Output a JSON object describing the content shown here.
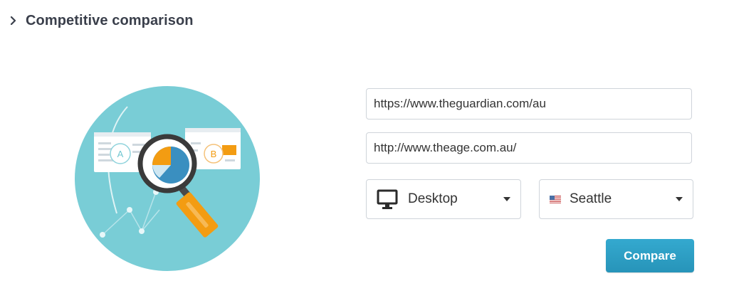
{
  "section": {
    "title": "Competitive comparison",
    "chevron_icon": "chevron-right-icon"
  },
  "illustration": {
    "icon": "magnifier-comparison-illustration",
    "badge_a": "A",
    "badge_b": "B",
    "colors": {
      "circle": "#79cdd6",
      "accent": "#f39c12",
      "pie": "#3a8fc0"
    }
  },
  "form": {
    "url_a": {
      "value": "https://www.theguardian.com/au"
    },
    "url_b": {
      "value": "http://www.theage.com.au/"
    },
    "device": {
      "icon": "desktop-monitor-icon",
      "selected": "Desktop"
    },
    "location": {
      "icon": "us-flag-icon",
      "selected": "Seattle"
    },
    "compare_label": "Compare"
  },
  "colors": {
    "button": "#2ea0c5",
    "border": "#cfd4da",
    "title": "#3a3f4b"
  }
}
